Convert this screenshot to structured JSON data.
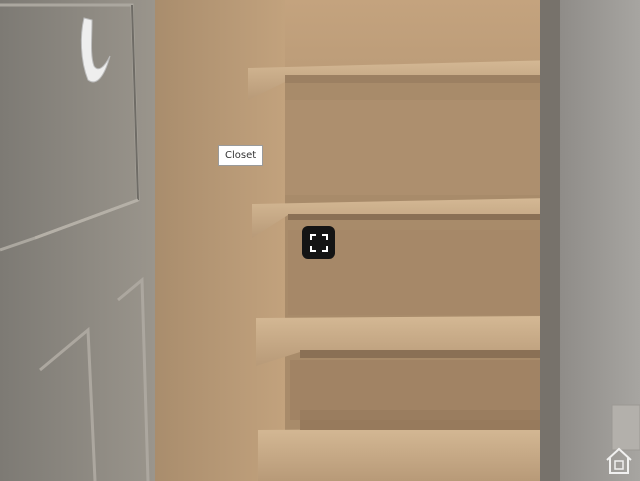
{
  "hotspot": {
    "label": "Closet"
  },
  "controls": {
    "expand_icon": "fullscreen-expand-icon"
  },
  "watermark": {
    "icon": "house-logo-icon"
  },
  "colors": {
    "wall": "#b89a78",
    "shelf": "#c9ac8a",
    "door": "#8d8a83",
    "trim": "#a9a39a",
    "button_bg": "#141414"
  }
}
